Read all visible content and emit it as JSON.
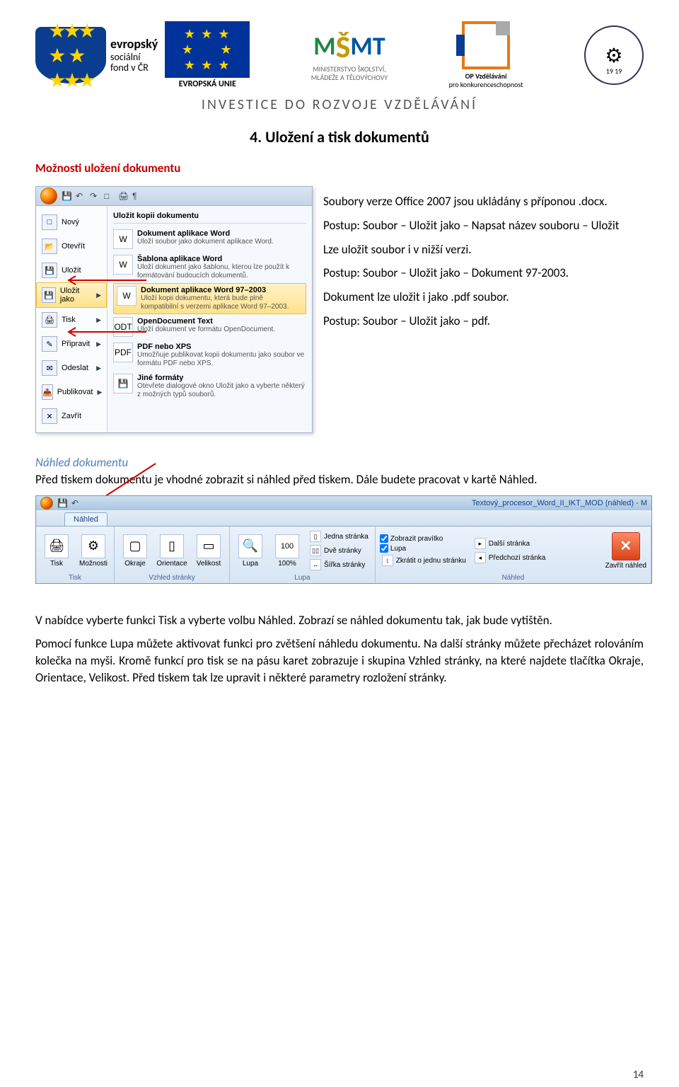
{
  "header": {
    "esf_text_lines": [
      "evropský",
      "sociální",
      "fond v ČR"
    ],
    "eu_label": "EVROPSKÁ UNIE",
    "msmt_lines": [
      "MINISTERSTVO ŠKOLSTVÍ,",
      "MLÁDEŽE A TĚLOVÝCHOVY"
    ],
    "op_lines": [
      "OP Vzdělávání",
      "pro konkurenceschopnost"
    ],
    "emblem_year": "19 19",
    "investice": "INVESTICE DO ROZVOJE VZDĚLÁVÁNÍ"
  },
  "title": "4. Uložení a tisk dokumentů",
  "h_red_1": "Možnosti uložení dokumentu",
  "right_col": {
    "p1": "Soubory verze Office 2007 jsou ukládány s příponou .docx.",
    "p2": "Postup: Soubor – Uložit jako – Napsat název souboru – Uložit",
    "p3": "Lze uložit soubor i v nižší verzi.",
    "p4": "Postup: Soubor – Uložit jako – Dokument 97-2003.",
    "p5": "Dokument lze uložit i jako .pdf soubor.",
    "p6": "Postup: Soubor – Uložit jako – pdf."
  },
  "office_menu": {
    "title_right": "Uložit kopii dokumentu",
    "left_items": [
      {
        "label": "Nový",
        "ico": "□"
      },
      {
        "label": "Otevřít",
        "ico": "📂"
      },
      {
        "label": "Uložit",
        "ico": "💾"
      },
      {
        "label": "Uložit jako",
        "ico": "💾",
        "hot": true,
        "arrow": true
      },
      {
        "label": "Tisk",
        "ico": "🖨",
        "arrow": true
      },
      {
        "label": "Připravit",
        "ico": "✎",
        "arrow": true
      },
      {
        "label": "Odeslat",
        "ico": "✉",
        "arrow": true
      },
      {
        "label": "Publikovat",
        "ico": "📤",
        "arrow": true
      },
      {
        "label": "Zavřít",
        "ico": "✕"
      }
    ],
    "right_items": [
      {
        "title": "Dokument aplikace Word",
        "desc": "Uloží soubor jako dokument aplikace Word.",
        "ico": "W"
      },
      {
        "title": "Šablona aplikace Word",
        "desc": "Uloží dokument jako šablonu, kterou lze použít k formátování budoucích dokumentů.",
        "ico": "W"
      },
      {
        "title": "Dokument aplikace Word 97–2003",
        "desc": "Uloží kopii dokumentu, která bude plně kompatibilní s verzemi aplikace Word 97–2003.",
        "ico": "W",
        "hot": true
      },
      {
        "title": "OpenDocument Text",
        "desc": "Uloží dokument ve formátu OpenDocument.",
        "ico": "ODT"
      },
      {
        "title": "PDF nebo XPS",
        "desc": "Umožňuje publikovat kopii dokumentu jako soubor ve formátu PDF nebo XPS.",
        "ico": "PDF"
      },
      {
        "title": "Jiné formáty",
        "desc": "Otevřete dialogové okno Uložit jako a vyberte některý z možných typů souborů.",
        "ico": "💾"
      }
    ]
  },
  "h_blue_1": "Náhled dokumentu",
  "p_nahled": "Před tiskem dokumentu je vhodné zobrazit si náhled před tiskem. Dále budete pracovat v kartě Náhled.",
  "ribbon": {
    "title_doc": "Textový_procesor_Word_II_IKT_MOD (náhled) - M",
    "tab": "Náhled",
    "groups": {
      "tisk": "Tisk",
      "vzhled": "Vzhled stránky",
      "lupa": "Lupa",
      "nahled": "Náhled"
    },
    "btn_tisk": "Tisk",
    "btn_moznosti": "Možnosti",
    "btn_okraje": "Okraje",
    "btn_orientace": "Orientace",
    "btn_velikost": "Velikost",
    "btn_lupa": "Lupa",
    "btn_100": "100%",
    "s_jedna": "Jedna stránka",
    "s_dve": "Dvě stránky",
    "s_sirka": "Šířka stránky",
    "c_prav": "Zobrazit pravítko",
    "c_lupa": "Lupa",
    "c_zkr": "Zkrátit o jednu stránku",
    "s_dalsi": "Další stránka",
    "s_pred": "Předchozí stránka",
    "btn_zavrit": "Zavřít náhled"
  },
  "p_after_ribbon_1": "V nabídce vyberte funkci Tisk a vyberte volbu Náhled. Zobrazí se náhled dokumentu tak, jak bude vytištěn.",
  "p_after_ribbon_2": "Pomocí funkce Lupa můžete aktivovat funkci pro zvětšení náhledu dokumentu. Na další stránky můžete přecházet rolováním kolečka na myši. Kromě funkcí pro tisk se na pásu karet zobrazuje i skupina Vzhled stránky, na které najdete tlačítka Okraje, Orientace, Velikost. Před tiskem tak lze upravit i některé parametry rozložení stránky.",
  "page_num": "14"
}
